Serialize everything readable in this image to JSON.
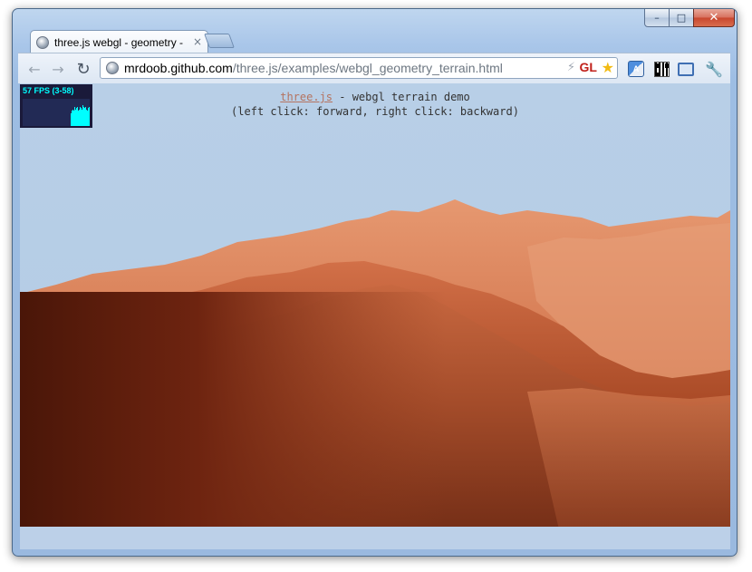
{
  "window": {
    "minimize_label": "–",
    "maximize_label": "□",
    "close_label": "✕"
  },
  "tab": {
    "title": "three.js webgl - geometry -",
    "close_label": "×"
  },
  "toolbar": {
    "back_label": "←",
    "forward_label": "→",
    "reload_label": "↻",
    "url_host": "mrdoob.github.com",
    "url_path": "/three.js/examples/webgl_geometry_terrain.html",
    "gl_badge": "GL",
    "translate_label": "A",
    "wrench_label": "🔧"
  },
  "page": {
    "link_text": "three.js",
    "title_rest": " - webgl terrain demo",
    "instructions": "(left click: forward, right click: backward)",
    "fps_text": "57 FPS (3-58)",
    "fps_graph": [
      0.45,
      0.55,
      0.6,
      0.55,
      0.7,
      0.6,
      0.65,
      0.7,
      0.55,
      0.6,
      0.7,
      0.65,
      0.6,
      0.75,
      0.7,
      0.65,
      0.7,
      0.6,
      0.55,
      0.65,
      0.7
    ]
  },
  "colors": {
    "sky": "#b5cde6",
    "terrain_light": "#e08a62",
    "terrain_mid": "#b85a34",
    "terrain_dark": "#5a1c0c",
    "fps_text": "#00ffff"
  }
}
